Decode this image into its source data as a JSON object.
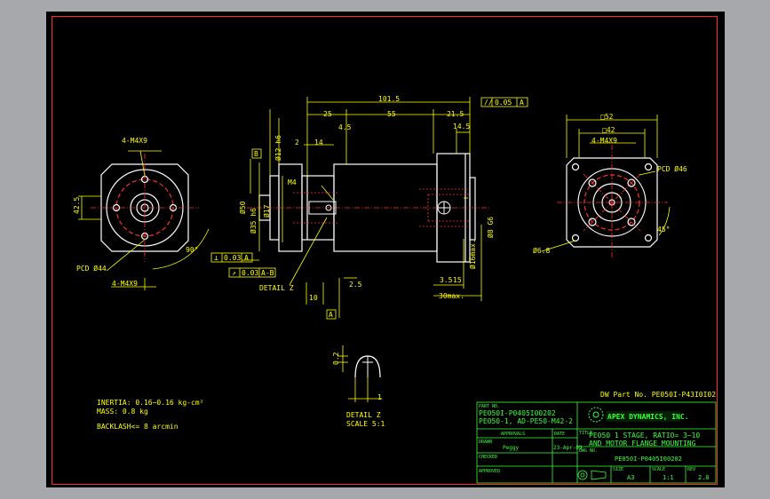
{
  "drawing": {
    "dwg_part_no": "DW Part No. PE050I-P43I0I02",
    "notes": {
      "inertia": "INERTIA: 0.16~0.16 kg-cm²",
      "mass": "MASS: 0.8 kg",
      "backlash": "BACKLASH<= 8 arcmin"
    },
    "detail_label": "DETAIL Z",
    "detail_scale": "SCALE  5:1",
    "detail_callout": "DETAIL Z"
  },
  "front_view": {
    "pcd": "PCD Ø44",
    "thread_top": "4-M4X9",
    "thread_bottom": "4-M4X9",
    "angle": "90°",
    "dim_side": "42.5"
  },
  "side_view": {
    "overall": "101.5",
    "d25": "25",
    "d55": "55",
    "d215": "21.5",
    "d45": "4.5",
    "d14": "14",
    "d2": "2",
    "d145": "14.5",
    "d10": "10",
    "d25b": "2.5",
    "d35": "3.5",
    "d15": "15",
    "max30": "30max.",
    "thread_m4": "M4",
    "dia12": "Ø12 h6",
    "dia50": "Ø50",
    "dia35": "Ø35 h6",
    "dia17": "Ø17",
    "dia8": "Ø8 G6",
    "dia16": "Ø16max.",
    "gdt_flat": "0.05",
    "gdt_flat_ref": "A",
    "gdt_perp": "0.03",
    "gdt_perp_ref": "A",
    "gdt_run": "0.03",
    "gdt_run_ref": "A-B",
    "datum_a": "A",
    "datum_b": "B"
  },
  "right_view": {
    "sq52": "□52",
    "sq42": "□42",
    "thread": "4-M4X9",
    "pcd": "PCD Ø46",
    "angle": "45°",
    "hole": "Ø6.8"
  },
  "detail": {
    "d02": "0.2",
    "d1": "1"
  },
  "title_block": {
    "part_no_label": "PART NO.",
    "part_no_1": "PE050I-P0405I00202",
    "part_no_2": "PE050-1, AD-PE50-M42-2",
    "approvals": "APPROVALS",
    "date_label": "DATE",
    "company": "APEX DYNAMICS, INC.",
    "title_label": "TITLE",
    "title_1": "PE050 1 STAGE, RATIO= 3~10",
    "title_2": "AND MOTOR FLANGE MOUNTING",
    "drawn_label": "DRAWN",
    "drawn": "Peggy",
    "date": "23-Apr-09",
    "checked_label": "CHECKED",
    "dwg_no_label": "DWG NO.",
    "dwg_no": "PE050I-P0405I00202",
    "approved_label": "APPROVED",
    "size_label": "SIZE",
    "size": "A3",
    "scale_label": "SCALE",
    "scale": "1:1",
    "rev_label": "REV",
    "rev": "2.0"
  }
}
